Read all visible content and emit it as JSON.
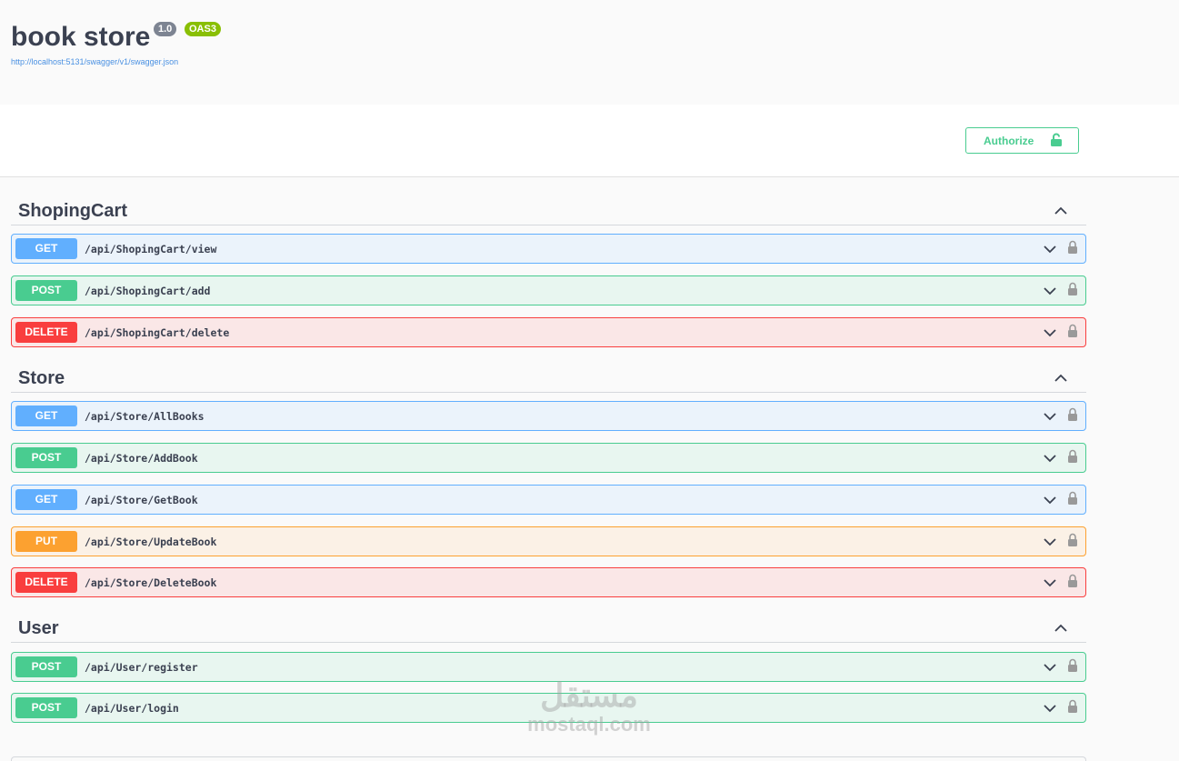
{
  "info": {
    "title": "book store",
    "version": "1.0",
    "oas": "OAS3",
    "spec_url": "http://localhost:5131/swagger/v1/swagger.json"
  },
  "authorize": {
    "label": "Authorize"
  },
  "tags": [
    {
      "name": "ShopingCart",
      "operations": [
        {
          "method": "GET",
          "path": "/api/ShopingCart/view"
        },
        {
          "method": "POST",
          "path": "/api/ShopingCart/add"
        },
        {
          "method": "DELETE",
          "path": "/api/ShopingCart/delete"
        }
      ]
    },
    {
      "name": "Store",
      "operations": [
        {
          "method": "GET",
          "path": "/api/Store/AllBooks"
        },
        {
          "method": "POST",
          "path": "/api/Store/AddBook"
        },
        {
          "method": "GET",
          "path": "/api/Store/GetBook"
        },
        {
          "method": "PUT",
          "path": "/api/Store/UpdateBook"
        },
        {
          "method": "DELETE",
          "path": "/api/Store/DeleteBook"
        }
      ]
    },
    {
      "name": "User",
      "operations": [
        {
          "method": "POST",
          "path": "/api/User/register"
        },
        {
          "method": "POST",
          "path": "/api/User/login"
        }
      ]
    }
  ],
  "watermark": {
    "arabic": "مستقل",
    "latin": "mostaql.com"
  },
  "colors": {
    "get": "#61affe",
    "post": "#49cc90",
    "delete": "#f93e3e",
    "put": "#fca130"
  },
  "icons": {
    "collapse": "chevron-up-icon",
    "expand": "chevron-down-icon",
    "lock": "lock-icon"
  }
}
